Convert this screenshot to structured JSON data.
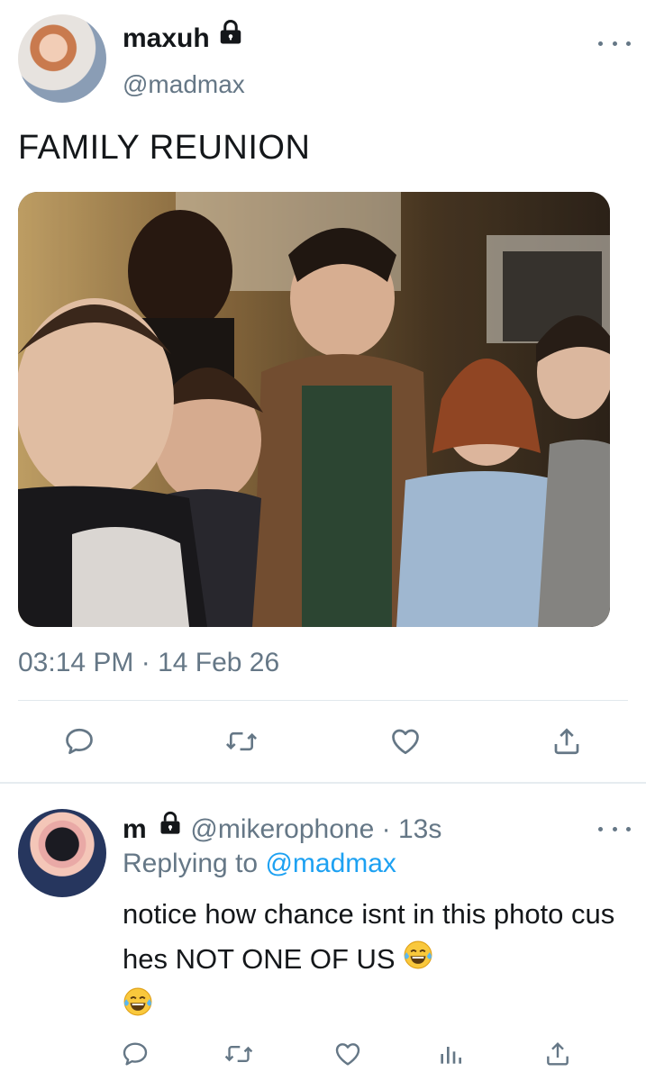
{
  "tweet": {
    "author_name": "maxuh",
    "author_handle": "@madmax",
    "text": "FAMILY REUNION",
    "timestamp": "03:14 PM · 14 Feb 26",
    "icons": {
      "lock": "lock-icon",
      "more": "more-icon",
      "reply": "reply-icon",
      "retweet": "retweet-icon",
      "like": "heart-icon",
      "share": "share-icon"
    }
  },
  "reply": {
    "author_name": "m",
    "author_handle": "@mikerophone",
    "time": "13s",
    "replying_prefix": "Replying to",
    "replying_to": "@madmax",
    "text": "notice how chance isnt in this photo cus hes NOT ONE OF US",
    "emojis": [
      "face-with-tears-of-joy-emoji",
      "face-with-tears-of-joy-emoji"
    ],
    "icons": {
      "reply": "reply-icon",
      "retweet": "retweet-icon",
      "like": "heart-icon",
      "analytics": "analytics-icon",
      "share": "share-icon"
    }
  },
  "colors": {
    "text_primary": "#14171a",
    "text_secondary": "#657786",
    "link": "#1da1f2",
    "divider": "#e1e8ed"
  }
}
